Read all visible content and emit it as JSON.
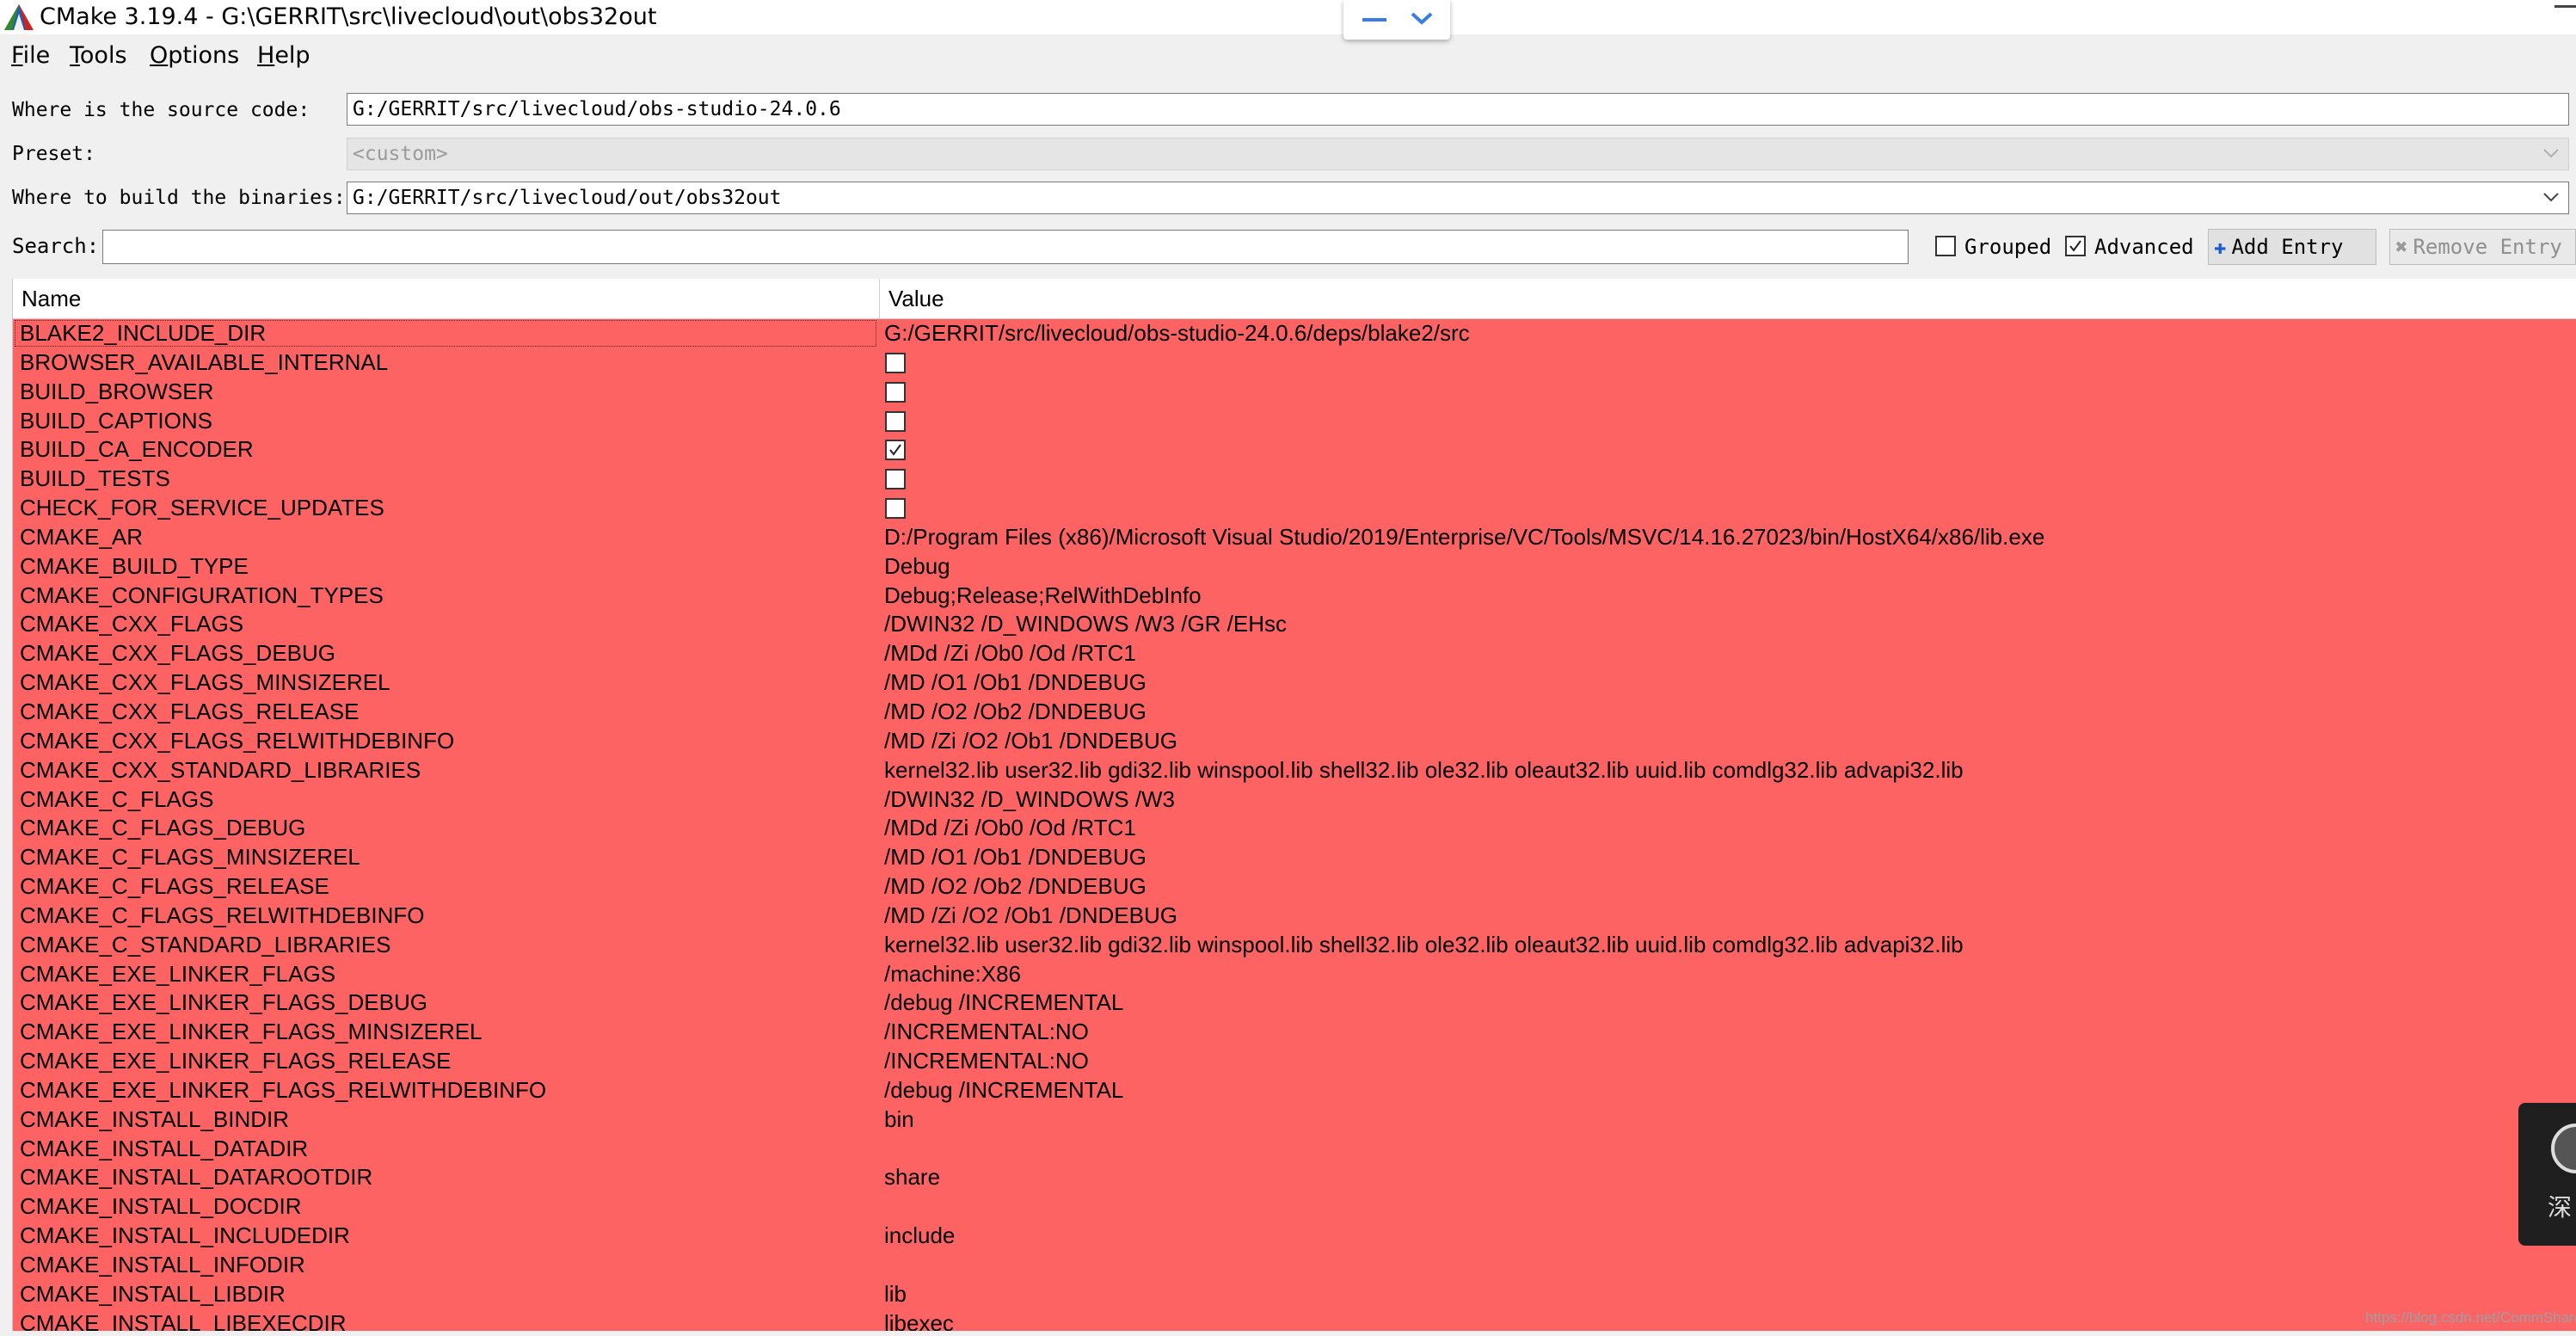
{
  "window": {
    "title": "CMake 3.19.4 - G:\\GERRIT\\src\\livecloud\\out\\obs32out"
  },
  "menu": [
    {
      "acc": "F",
      "rest": "ile"
    },
    {
      "acc": "T",
      "rest": "ools"
    },
    {
      "acc": "O",
      "rest": "ptions"
    },
    {
      "acc": "H",
      "rest": "elp"
    }
  ],
  "form": {
    "source_label": "Where is the source code:",
    "source_value": "G:/GERRIT/src/livecloud/obs-studio-24.0.6",
    "preset_label": "Preset:",
    "preset_value": "<custom>",
    "binaries_label": "Where to build the binaries:",
    "binaries_value": "G:/GERRIT/src/livecloud/out/obs32out"
  },
  "toolbar": {
    "search_label": "Search:",
    "search_value": "",
    "grouped_label": "Grouped",
    "grouped_checked": false,
    "advanced_label": "Advanced",
    "advanced_checked": true,
    "add_entry_label": "Add Entry",
    "remove_entry_label": "Remove Entry"
  },
  "table": {
    "headers": {
      "name": "Name",
      "value": "Value"
    },
    "row_color": "#fe6363",
    "rows": [
      {
        "name": "BLAKE2_INCLUDE_DIR",
        "value": "G:/GERRIT/src/livecloud/obs-studio-24.0.6/deps/blake2/src",
        "selected": true
      },
      {
        "name": "BROWSER_AVAILABLE_INTERNAL",
        "bool": false
      },
      {
        "name": "BUILD_BROWSER",
        "bool": false
      },
      {
        "name": "BUILD_CAPTIONS",
        "bool": false
      },
      {
        "name": "BUILD_CA_ENCODER",
        "bool": true
      },
      {
        "name": "BUILD_TESTS",
        "bool": false
      },
      {
        "name": "CHECK_FOR_SERVICE_UPDATES",
        "bool": false
      },
      {
        "name": "CMAKE_AR",
        "value": "D:/Program Files (x86)/Microsoft Visual Studio/2019/Enterprise/VC/Tools/MSVC/14.16.27023/bin/HostX64/x86/lib.exe"
      },
      {
        "name": "CMAKE_BUILD_TYPE",
        "value": "Debug"
      },
      {
        "name": "CMAKE_CONFIGURATION_TYPES",
        "value": "Debug;Release;RelWithDebInfo"
      },
      {
        "name": "CMAKE_CXX_FLAGS",
        "value": "/DWIN32 /D_WINDOWS /W3 /GR /EHsc"
      },
      {
        "name": "CMAKE_CXX_FLAGS_DEBUG",
        "value": "/MDd /Zi /Ob0 /Od /RTC1"
      },
      {
        "name": "CMAKE_CXX_FLAGS_MINSIZEREL",
        "value": "/MD /O1 /Ob1 /DNDEBUG"
      },
      {
        "name": "CMAKE_CXX_FLAGS_RELEASE",
        "value": "/MD /O2 /Ob2 /DNDEBUG"
      },
      {
        "name": "CMAKE_CXX_FLAGS_RELWITHDEBINFO",
        "value": "/MD /Zi /O2 /Ob1 /DNDEBUG"
      },
      {
        "name": "CMAKE_CXX_STANDARD_LIBRARIES",
        "value": "kernel32.lib user32.lib gdi32.lib winspool.lib shell32.lib ole32.lib oleaut32.lib uuid.lib comdlg32.lib advapi32.lib"
      },
      {
        "name": "CMAKE_C_FLAGS",
        "value": "/DWIN32 /D_WINDOWS /W3"
      },
      {
        "name": "CMAKE_C_FLAGS_DEBUG",
        "value": "/MDd /Zi /Ob0 /Od /RTC1"
      },
      {
        "name": "CMAKE_C_FLAGS_MINSIZEREL",
        "value": "/MD /O1 /Ob1 /DNDEBUG"
      },
      {
        "name": "CMAKE_C_FLAGS_RELEASE",
        "value": "/MD /O2 /Ob2 /DNDEBUG"
      },
      {
        "name": "CMAKE_C_FLAGS_RELWITHDEBINFO",
        "value": "/MD /Zi /O2 /Ob1 /DNDEBUG"
      },
      {
        "name": "CMAKE_C_STANDARD_LIBRARIES",
        "value": "kernel32.lib user32.lib gdi32.lib winspool.lib shell32.lib ole32.lib oleaut32.lib uuid.lib comdlg32.lib advapi32.lib"
      },
      {
        "name": "CMAKE_EXE_LINKER_FLAGS",
        "value": "/machine:X86"
      },
      {
        "name": "CMAKE_EXE_LINKER_FLAGS_DEBUG",
        "value": "/debug /INCREMENTAL"
      },
      {
        "name": "CMAKE_EXE_LINKER_FLAGS_MINSIZEREL",
        "value": "/INCREMENTAL:NO"
      },
      {
        "name": "CMAKE_EXE_LINKER_FLAGS_RELEASE",
        "value": "/INCREMENTAL:NO"
      },
      {
        "name": "CMAKE_EXE_LINKER_FLAGS_RELWITHDEBINFO",
        "value": "/debug /INCREMENTAL"
      },
      {
        "name": "CMAKE_INSTALL_BINDIR",
        "value": "bin"
      },
      {
        "name": "CMAKE_INSTALL_DATADIR",
        "value": ""
      },
      {
        "name": "CMAKE_INSTALL_DATAROOTDIR",
        "value": "share"
      },
      {
        "name": "CMAKE_INSTALL_DOCDIR",
        "value": ""
      },
      {
        "name": "CMAKE_INSTALL_INCLUDEDIR",
        "value": "include"
      },
      {
        "name": "CMAKE_INSTALL_INFODIR",
        "value": ""
      },
      {
        "name": "CMAKE_INSTALL_LIBDIR",
        "value": "lib"
      },
      {
        "name": "CMAKE_INSTALL_LIBEXECDIR",
        "value": "libexec"
      }
    ]
  },
  "side_widget": {
    "text": "深"
  },
  "watermark": "https://blog.csdn.net/CommShare",
  "icons": {
    "app": "cmake-triangle-icon",
    "float_min": "minus-icon",
    "float_collapse": "chevron-down-icon",
    "add": "plus-icon",
    "remove": "x-icon"
  }
}
